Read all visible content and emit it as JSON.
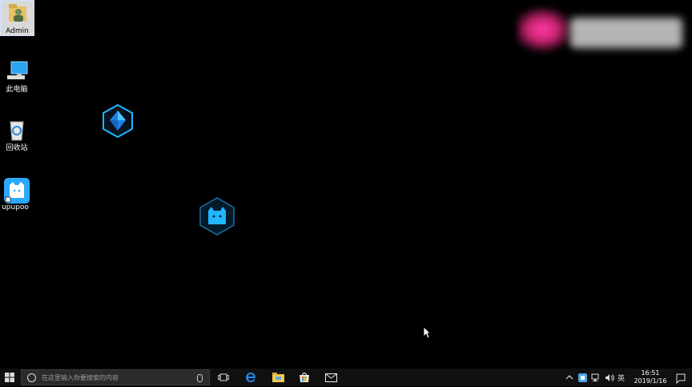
{
  "desktop": {
    "icons": [
      {
        "label": "Admin"
      },
      {
        "label": "此电脑"
      },
      {
        "label": "回收站"
      },
      {
        "label": "upupoo"
      }
    ]
  },
  "taskbar": {
    "search_placeholder": "在这里输入你要搜索的内容",
    "pinned": [
      "task-view-icon",
      "edge-icon",
      "file-explorer-icon",
      "store-icon",
      "mail-icon"
    ],
    "tray": {
      "ime": "英",
      "time": "16:51",
      "date": "2019/1/16"
    }
  },
  "colors": {
    "taskbar_bg": "#101010",
    "accent_cyan": "#1fb6ff",
    "edge_blue": "#1e88e5",
    "folder_yellow": "#f2c94c"
  }
}
